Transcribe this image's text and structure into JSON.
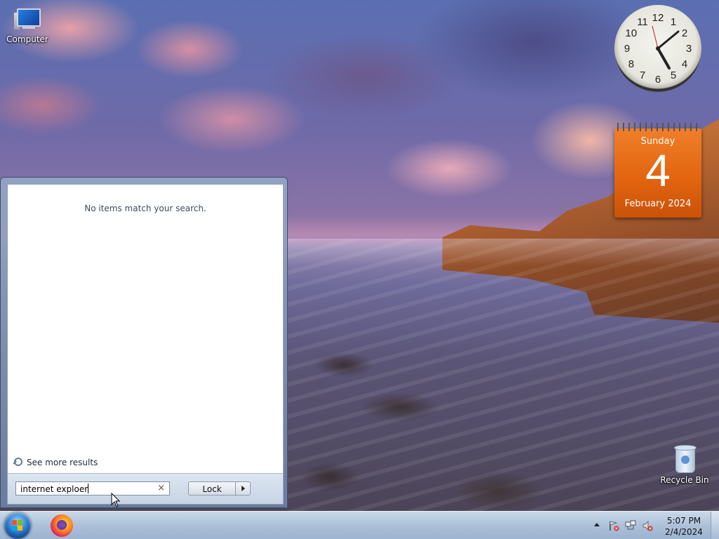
{
  "desktop": {
    "icons": [
      {
        "label": "Computer"
      },
      {
        "label": "Recycle Bin"
      }
    ]
  },
  "gadgets": {
    "clock": {
      "hour_numbers": [
        "12",
        "1",
        "2",
        "3",
        "4",
        "5",
        "6",
        "7",
        "8",
        "9",
        "10",
        "11"
      ],
      "time": "5:07"
    },
    "calendar": {
      "day_name": "Sunday",
      "day_number": "4",
      "month_year": "February 2024"
    }
  },
  "start_menu": {
    "no_results_text": "No items match your search.",
    "see_more_label": "See more results",
    "search": {
      "value": "internet exploer",
      "clear_glyph": "×"
    },
    "power_button_label": "Lock"
  },
  "taskbar": {
    "pinned": [
      "Firefox"
    ],
    "clock": {
      "time": "5:07 PM",
      "date": "2/4/2024"
    },
    "tray_icons": [
      "show-hidden-icons",
      "action-center-icon",
      "network-icon",
      "volume-muted-icon"
    ]
  },
  "colors": {
    "calendar_orange": "#e3650f",
    "taskbar": "#a8bed7"
  }
}
